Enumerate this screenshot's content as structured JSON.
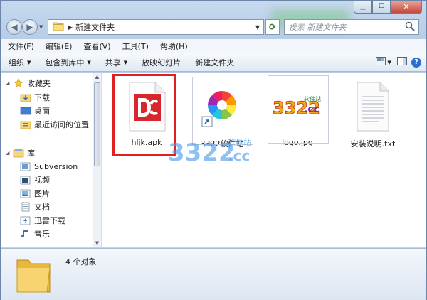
{
  "window": {
    "path": "新建文件夹",
    "search_placeholder": "搜索 新建文件夹"
  },
  "menubar": [
    {
      "label": "文件(F)",
      "name": "menu-file"
    },
    {
      "label": "编辑(E)",
      "name": "menu-edit"
    },
    {
      "label": "查看(V)",
      "name": "menu-view"
    },
    {
      "label": "工具(T)",
      "name": "menu-tools"
    },
    {
      "label": "帮助(H)",
      "name": "menu-help"
    }
  ],
  "commandbar": {
    "organize": "组织",
    "include_in_library": "包含到库中",
    "share": "共享",
    "slideshow": "放映幻灯片",
    "new_folder": "新建文件夹"
  },
  "nav": {
    "favorites": "收藏夹",
    "downloads": "下载",
    "desktop": "桌面",
    "recent": "最近访问的位置",
    "libraries": "库",
    "subversion": "Subversion",
    "videos": "视频",
    "pictures": "图片",
    "documents": "文档",
    "thunder": "迅雷下载",
    "music": "音乐"
  },
  "files": [
    {
      "name": "hljk.apk",
      "icon": "apk-file-icon",
      "selected": true
    },
    {
      "name": "3322软件站",
      "icon": "shortcut-icon",
      "selected": false
    },
    {
      "name": "logo.jpg",
      "icon": "image-thumbnail",
      "selected": false
    },
    {
      "name": "安装说明.txt",
      "icon": "text-file-icon",
      "selected": false
    }
  ],
  "logo_text": {
    "digits": "3322",
    "site_label": "软件站",
    "domain": ".cc"
  },
  "watermark": {
    "digits": "3322",
    "site_label": "软件站",
    "domain": ".cc"
  },
  "status": {
    "count": "4 个对象"
  },
  "colors": {
    "selection_border": "#e02020",
    "accent": "#2e6fc5"
  }
}
